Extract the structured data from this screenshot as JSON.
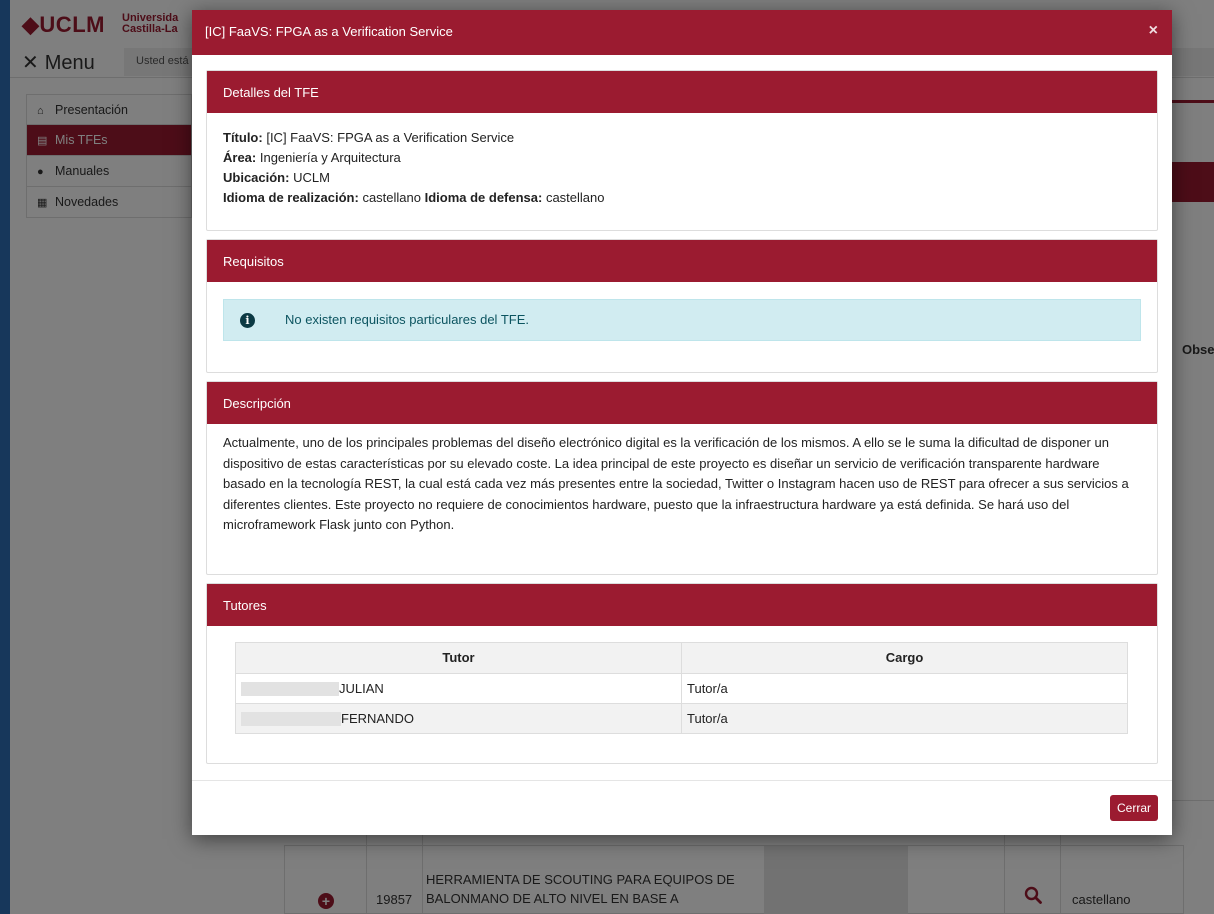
{
  "background": {
    "logo": "◆UCLM",
    "logo_sub_1": "Universida",
    "logo_sub_2": "Castilla-La",
    "menu_label": "Menu",
    "breadcrumb": "Usted está",
    "sidebar": [
      {
        "icon": "home-icon",
        "label": "Presentación"
      },
      {
        "icon": "document-icon",
        "label": "Mis TFEs",
        "active": true
      },
      {
        "icon": "info-icon",
        "label": "Manuales"
      },
      {
        "icon": "news-icon",
        "label": "Novedades"
      }
    ],
    "column_observ": "Obse",
    "row": {
      "number": "19857",
      "title": "HERRAMIENTA DE SCOUTING PARA EQUIPOS DE BALONMANO DE ALTO NIVEL EN BASE A",
      "language": "castellano"
    }
  },
  "modal": {
    "title": "[IC] FaaVS: FPGA as a Verification Service",
    "close_symbol": "×",
    "details": {
      "heading": "Detalles del TFE",
      "titulo_label": "Título:",
      "titulo_value": " [IC] FaaVS: FPGA as a Verification Service",
      "area_label": "Área:",
      "area_value": " Ingeniería y Arquitectura",
      "ubicacion_label": "Ubicación:",
      "ubicacion_value": " UCLM",
      "idioma_real_label": "Idioma de realización:",
      "idioma_real_value": " castellano ",
      "idioma_def_label": "Idioma de defensa:",
      "idioma_def_value": " castellano"
    },
    "requisitos": {
      "heading": "Requisitos",
      "alert_icon": "i",
      "alert_text": "No existen requisitos particulares del TFE."
    },
    "descripcion": {
      "heading": "Descripción",
      "text": "Actualmente, uno de los principales problemas del diseño electrónico digital es la verificación de los mismos. A ello se le suma la dificultad de disponer un dispositivo de estas características por su elevado coste. La idea principal de este proyecto es diseñar un servicio de verificación transparente hardware basado en la tecnología REST, la cual está cada vez más presentes entre la sociedad, Twitter o Instagram hacen uso de REST para ofrecer a sus servicios a diferentes clientes. Este proyecto no requiere de conocimientos hardware, puesto que la infraestructura hardware ya está definida. Se hará uso del microframework Flask junto con Python."
    },
    "tutores": {
      "heading": "Tutores",
      "columns": [
        "Tutor",
        "Cargo"
      ],
      "rows": [
        {
          "tutor": "JULIAN",
          "cargo": "Tutor/a"
        },
        {
          "tutor": "FERNANDO",
          "cargo": "Tutor/a"
        }
      ]
    },
    "footer": {
      "close_button": "Cerrar"
    }
  },
  "colors": {
    "brand_red": "#9b1b30",
    "alert_bg": "#d1ecf1",
    "alert_text": "#0c5460"
  }
}
